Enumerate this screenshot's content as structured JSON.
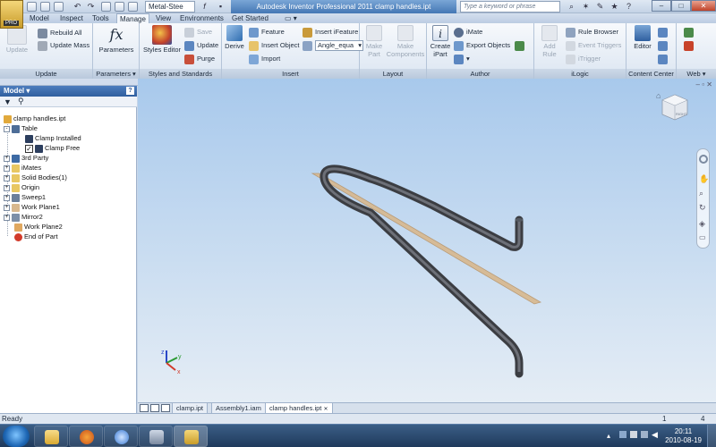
{
  "titlebar": {
    "title": "Autodesk Inventor Professional 2011    clamp handles.ipt",
    "material": "Metal-Stee",
    "search_placeholder": "Type a keyword or phrase",
    "logo_badge": "PRO"
  },
  "tabs": [
    {
      "label": "Model"
    },
    {
      "label": "Inspect"
    },
    {
      "label": "Tools"
    },
    {
      "label": "Manage"
    },
    {
      "label": "View"
    },
    {
      "label": "Environments"
    },
    {
      "label": "Get Started"
    }
  ],
  "ribbon": {
    "update": {
      "update": "Update",
      "rebuild_all": "Rebuild All",
      "update_mass": "Update Mass",
      "label": "Update"
    },
    "parameters": {
      "parameters": "Parameters",
      "label": "Parameters ▾"
    },
    "styles": {
      "styles_editor": "Styles Editor",
      "save": "Save",
      "update": "Update",
      "purge": "Purge",
      "label": "Styles and Standards"
    },
    "insert": {
      "derive": "Derive",
      "feature": "Feature",
      "insert_object": "Insert Object",
      "import": "Import",
      "insert_ifeature": "Insert iFeature",
      "angle_combo": "Angle_equa",
      "label": "Insert"
    },
    "layout": {
      "make_part_1": "Make",
      "make_part_2": "Part",
      "make_components_1": "Make",
      "make_components_2": "Components",
      "label": "Layout"
    },
    "author": {
      "create_ipart_1": "Create",
      "create_ipart_2": "iPart",
      "imate": "iMate",
      "export_objects": "Export Objects",
      "label": "Author"
    },
    "ilogic": {
      "add_rule": "Add Rule",
      "rule_browser": "Rule Browser",
      "event_triggers": "Event Triggers",
      "itrigger": "iTrigger",
      "label": "iLogic"
    },
    "content_center": {
      "editor": "Editor",
      "label": "Content Center"
    },
    "web": {
      "label": "Web ▾"
    }
  },
  "browser": {
    "title": "Model ▾",
    "help": "?",
    "items": [
      {
        "label": "clamp handles.ipt"
      },
      {
        "label": "Table"
      },
      {
        "label": "Clamp Installed"
      },
      {
        "label": "Clamp Free"
      },
      {
        "label": "3rd Party"
      },
      {
        "label": "iMates"
      },
      {
        "label": "Solid Bodies(1)"
      },
      {
        "label": "Origin"
      },
      {
        "label": "Sweep1"
      },
      {
        "label": "Work Plane1"
      },
      {
        "label": "Mirror2"
      },
      {
        "label": "Work Plane2"
      },
      {
        "label": "End of Part"
      }
    ]
  },
  "doctabs": [
    {
      "label": "clamp.ipt"
    },
    {
      "label": "Assembly1.iam"
    },
    {
      "label": "clamp handles.ipt"
    }
  ],
  "status": {
    "text": "Ready",
    "count1": "1",
    "count2": "4"
  },
  "taskbar": {
    "time": "20:11",
    "date": "2010-08-19"
  },
  "viewcube": {
    "face": "RIGHT"
  },
  "colors": {
    "accent": "#4477b4",
    "viewport_top": "#a8c9ec",
    "viewport_bottom": "#e5edf5",
    "workplane": "#d8b88e"
  }
}
